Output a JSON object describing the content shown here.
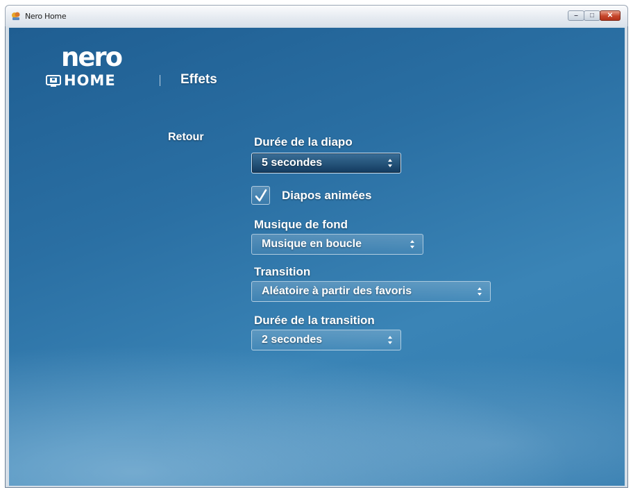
{
  "window": {
    "title": "Nero Home"
  },
  "logo": {
    "nero": "nero",
    "home": "HOME"
  },
  "header": {
    "section_title": "Effets"
  },
  "nav": {
    "back_label": "Retour"
  },
  "settings": {
    "slide_duration": {
      "label": "Durée de la diapo",
      "value": "5 secondes"
    },
    "animated_slides": {
      "label": "Diapos animées",
      "checked": true
    },
    "background_music": {
      "label": "Musique de fond",
      "value": "Musique en boucle"
    },
    "transition": {
      "label": "Transition",
      "value": "Aléatoire à partir des favoris"
    },
    "transition_duration": {
      "label": "Durée de la transition",
      "value": "2 secondes"
    }
  },
  "colors": {
    "background": "#2f74a8",
    "text": "#ffffff",
    "close_button": "#c5452a"
  },
  "icons": [
    "app-icon",
    "minimize-icon",
    "maximize-icon",
    "close-icon",
    "home-screen-icon",
    "checkmark-icon",
    "select-arrows-icon"
  ]
}
